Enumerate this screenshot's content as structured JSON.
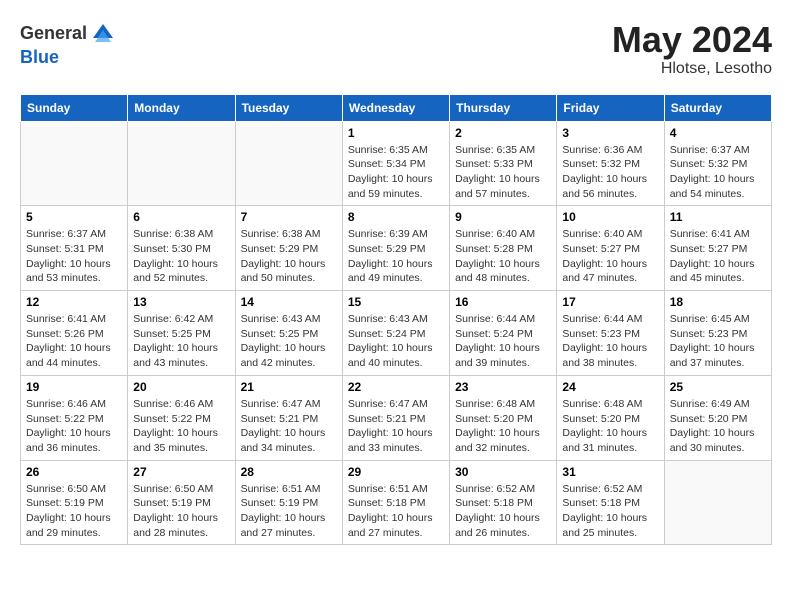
{
  "logo": {
    "general": "General",
    "blue": "Blue"
  },
  "title": {
    "month_year": "May 2024",
    "location": "Hlotse, Lesotho"
  },
  "weekdays": [
    "Sunday",
    "Monday",
    "Tuesday",
    "Wednesday",
    "Thursday",
    "Friday",
    "Saturday"
  ],
  "weeks": [
    [
      {
        "day": "",
        "info": ""
      },
      {
        "day": "",
        "info": ""
      },
      {
        "day": "",
        "info": ""
      },
      {
        "day": "1",
        "info": "Sunrise: 6:35 AM\nSunset: 5:34 PM\nDaylight: 10 hours\nand 59 minutes."
      },
      {
        "day": "2",
        "info": "Sunrise: 6:35 AM\nSunset: 5:33 PM\nDaylight: 10 hours\nand 57 minutes."
      },
      {
        "day": "3",
        "info": "Sunrise: 6:36 AM\nSunset: 5:32 PM\nDaylight: 10 hours\nand 56 minutes."
      },
      {
        "day": "4",
        "info": "Sunrise: 6:37 AM\nSunset: 5:32 PM\nDaylight: 10 hours\nand 54 minutes."
      }
    ],
    [
      {
        "day": "5",
        "info": "Sunrise: 6:37 AM\nSunset: 5:31 PM\nDaylight: 10 hours\nand 53 minutes."
      },
      {
        "day": "6",
        "info": "Sunrise: 6:38 AM\nSunset: 5:30 PM\nDaylight: 10 hours\nand 52 minutes."
      },
      {
        "day": "7",
        "info": "Sunrise: 6:38 AM\nSunset: 5:29 PM\nDaylight: 10 hours\nand 50 minutes."
      },
      {
        "day": "8",
        "info": "Sunrise: 6:39 AM\nSunset: 5:29 PM\nDaylight: 10 hours\nand 49 minutes."
      },
      {
        "day": "9",
        "info": "Sunrise: 6:40 AM\nSunset: 5:28 PM\nDaylight: 10 hours\nand 48 minutes."
      },
      {
        "day": "10",
        "info": "Sunrise: 6:40 AM\nSunset: 5:27 PM\nDaylight: 10 hours\nand 47 minutes."
      },
      {
        "day": "11",
        "info": "Sunrise: 6:41 AM\nSunset: 5:27 PM\nDaylight: 10 hours\nand 45 minutes."
      }
    ],
    [
      {
        "day": "12",
        "info": "Sunrise: 6:41 AM\nSunset: 5:26 PM\nDaylight: 10 hours\nand 44 minutes."
      },
      {
        "day": "13",
        "info": "Sunrise: 6:42 AM\nSunset: 5:25 PM\nDaylight: 10 hours\nand 43 minutes."
      },
      {
        "day": "14",
        "info": "Sunrise: 6:43 AM\nSunset: 5:25 PM\nDaylight: 10 hours\nand 42 minutes."
      },
      {
        "day": "15",
        "info": "Sunrise: 6:43 AM\nSunset: 5:24 PM\nDaylight: 10 hours\nand 40 minutes."
      },
      {
        "day": "16",
        "info": "Sunrise: 6:44 AM\nSunset: 5:24 PM\nDaylight: 10 hours\nand 39 minutes."
      },
      {
        "day": "17",
        "info": "Sunrise: 6:44 AM\nSunset: 5:23 PM\nDaylight: 10 hours\nand 38 minutes."
      },
      {
        "day": "18",
        "info": "Sunrise: 6:45 AM\nSunset: 5:23 PM\nDaylight: 10 hours\nand 37 minutes."
      }
    ],
    [
      {
        "day": "19",
        "info": "Sunrise: 6:46 AM\nSunset: 5:22 PM\nDaylight: 10 hours\nand 36 minutes."
      },
      {
        "day": "20",
        "info": "Sunrise: 6:46 AM\nSunset: 5:22 PM\nDaylight: 10 hours\nand 35 minutes."
      },
      {
        "day": "21",
        "info": "Sunrise: 6:47 AM\nSunset: 5:21 PM\nDaylight: 10 hours\nand 34 minutes."
      },
      {
        "day": "22",
        "info": "Sunrise: 6:47 AM\nSunset: 5:21 PM\nDaylight: 10 hours\nand 33 minutes."
      },
      {
        "day": "23",
        "info": "Sunrise: 6:48 AM\nSunset: 5:20 PM\nDaylight: 10 hours\nand 32 minutes."
      },
      {
        "day": "24",
        "info": "Sunrise: 6:48 AM\nSunset: 5:20 PM\nDaylight: 10 hours\nand 31 minutes."
      },
      {
        "day": "25",
        "info": "Sunrise: 6:49 AM\nSunset: 5:20 PM\nDaylight: 10 hours\nand 30 minutes."
      }
    ],
    [
      {
        "day": "26",
        "info": "Sunrise: 6:50 AM\nSunset: 5:19 PM\nDaylight: 10 hours\nand 29 minutes."
      },
      {
        "day": "27",
        "info": "Sunrise: 6:50 AM\nSunset: 5:19 PM\nDaylight: 10 hours\nand 28 minutes."
      },
      {
        "day": "28",
        "info": "Sunrise: 6:51 AM\nSunset: 5:19 PM\nDaylight: 10 hours\nand 27 minutes."
      },
      {
        "day": "29",
        "info": "Sunrise: 6:51 AM\nSunset: 5:18 PM\nDaylight: 10 hours\nand 27 minutes."
      },
      {
        "day": "30",
        "info": "Sunrise: 6:52 AM\nSunset: 5:18 PM\nDaylight: 10 hours\nand 26 minutes."
      },
      {
        "day": "31",
        "info": "Sunrise: 6:52 AM\nSunset: 5:18 PM\nDaylight: 10 hours\nand 25 minutes."
      },
      {
        "day": "",
        "info": ""
      }
    ]
  ]
}
